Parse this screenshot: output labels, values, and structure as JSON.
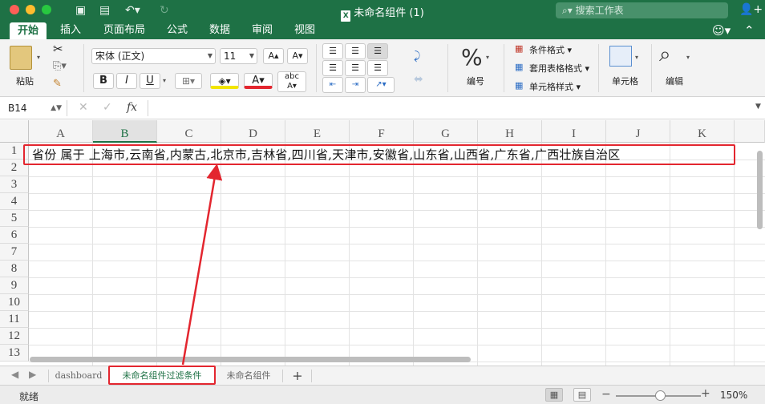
{
  "window": {
    "title": "未命名组件 (1)",
    "search_placeholder": "搜索工作表"
  },
  "ribbon_tabs": [
    "开始",
    "插入",
    "页面布局",
    "公式",
    "数据",
    "审阅",
    "视图"
  ],
  "ribbon": {
    "paste_label": "粘贴",
    "font_name": "宋体 (正文)",
    "font_size": "11",
    "bold": "B",
    "italic": "I",
    "underline": "U",
    "font_color_glyph": "A",
    "number_label": "编号",
    "percent_glyph": "%",
    "conditional_format": "条件格式",
    "table_format": "套用表格格式",
    "cell_styles": "单元格样式",
    "cells_label": "单元格",
    "edit_label": "编辑"
  },
  "formula_bar": {
    "name_box": "B14",
    "fx": "fx",
    "formula": ""
  },
  "sheet": {
    "columns": [
      "A",
      "B",
      "C",
      "D",
      "E",
      "F",
      "G",
      "H",
      "I",
      "J",
      "K"
    ],
    "selected_column": "B",
    "rows": [
      "1",
      "2",
      "3",
      "4",
      "5",
      "6",
      "7",
      "8",
      "9",
      "10",
      "11",
      "12",
      "13"
    ],
    "cell_a1": "省份  属于  上海市,云南省,内蒙古,北京市,吉林省,四川省,天津市,安徽省,山东省,山西省,广东省,广西壮族自治区"
  },
  "sheet_tabs": {
    "items": [
      "dashboard",
      "未命名组件过滤条件",
      "未命名组件"
    ],
    "active_index": 1,
    "add_label": "+"
  },
  "status": {
    "ready": "就绪",
    "zoom": "150%",
    "zoom_minus": "−",
    "zoom_plus": "+"
  },
  "colors": {
    "brand_green": "#1e7145",
    "annotation_red": "#e3262f"
  }
}
